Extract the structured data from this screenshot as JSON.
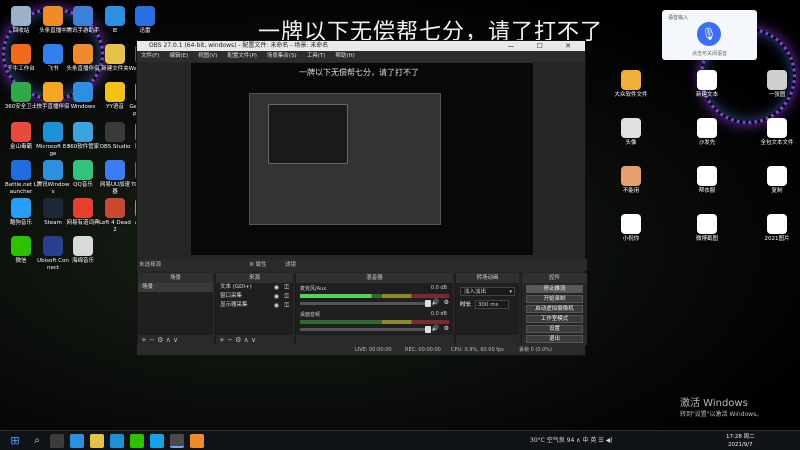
{
  "overlay": {
    "text": "一牌以下无偿帮七分，请了打不了"
  },
  "voice_widget": {
    "title": "语音输入",
    "status": "点击可关闭语音"
  },
  "desktop_icons": [
    {
      "label": "回收站",
      "color": "#9bb3c8"
    },
    {
      "label": "头条直播中",
      "color": "#f08b2c"
    },
    {
      "label": "腾讯手游助手",
      "color": "#3f7fd8"
    },
    {
      "label": "IE",
      "color": "#2d8fe0"
    },
    {
      "label": "迅雷",
      "color": "#2a6fe0"
    },
    {
      "label": "千牛工作台",
      "color": "#f26a1b"
    },
    {
      "label": "飞书",
      "color": "#2f80ed"
    },
    {
      "label": "头条直播伴侣",
      "color": "#f08b2c"
    },
    {
      "label": "新建文件夹",
      "color": "#e8c14a"
    },
    {
      "label": "Wallpaper Engine",
      "color": "#2f5fd0"
    },
    {
      "label": "360安全卫士",
      "color": "#30a94a"
    },
    {
      "label": "快手直播伴侣",
      "color": "#f5a623"
    },
    {
      "label": "Windows",
      "color": "#2d8fe0"
    },
    {
      "label": "YY语音",
      "color": "#f2c21a"
    },
    {
      "label": "GeForce Experience",
      "color": "#6cb33f"
    },
    {
      "label": "金山毒霸",
      "color": "#e84b3c"
    },
    {
      "label": "Microsoft Edge",
      "color": "#1e90d6"
    },
    {
      "label": "360软件管家",
      "color": "#3aa3e0"
    },
    {
      "label": "OBS Studio",
      "color": "#3a3a3a"
    },
    {
      "label": "腾讯QQ",
      "color": "#1aa2e8"
    },
    {
      "label": "Battle.net Launcher",
      "color": "#1e6ee0"
    },
    {
      "label": "腾讯Windows",
      "color": "#2d8fe0"
    },
    {
      "label": "QQ音乐",
      "color": "#31c27c"
    },
    {
      "label": "网易UU加速器",
      "color": "#3b7cf5"
    },
    {
      "label": "TC Games",
      "color": "#7b4df0"
    },
    {
      "label": "酷狗音乐",
      "color": "#2a9df4"
    },
    {
      "label": "Steam",
      "color": "#1b2838"
    },
    {
      "label": "网易有道词典",
      "color": "#e8402e"
    },
    {
      "label": "Left 4 Dead 2",
      "color": "#c8492f"
    },
    {
      "label": "a1eaeb",
      "color": "#6a9fd8"
    },
    {
      "label": "微信",
      "color": "#2dc100"
    },
    {
      "label": "Ubisoft Connect",
      "color": "#2a3f8f"
    },
    {
      "label": "海绵音乐",
      "color": "#d9d9d9"
    }
  ],
  "right_icons": [
    {
      "label": "大众软件文件",
      "color": "#f0b03a"
    },
    {
      "label": "新建文本",
      "color": "#ffffff"
    },
    {
      "label": "一张图",
      "color": "#cfcfcf"
    },
    {
      "label": "头像",
      "color": "#e0e0e0"
    },
    {
      "label": "沙发先",
      "color": "#ffffff"
    },
    {
      "label": "全包文本文件",
      "color": "#ffffff"
    },
    {
      "label": "不能用",
      "color": "#e8a070"
    },
    {
      "label": "帮衣服",
      "color": "#ffffff"
    },
    {
      "label": "复制",
      "color": "#ffffff"
    },
    {
      "label": "小祝你",
      "color": "#ffffff"
    },
    {
      "label": "微博截图",
      "color": "#ffffff"
    },
    {
      "label": "2021图片",
      "color": "#ffffff"
    }
  ],
  "obs": {
    "title": "OBS 27.0.1 (64-bit, windows) - 配置文件: 未命名 - 场景: 未命名",
    "win_buttons": "— ☐ ✕",
    "menu": [
      "文件(F)",
      "编辑(E)",
      "视图(V)",
      "配置文件(P)",
      "场景集合(S)",
      "工具(T)",
      "帮助(H)"
    ],
    "preview_text": "一牌以下无偿帮七分，请了打不了",
    "stream_status": "未选择源",
    "props_btn": "⚙ 属性",
    "filter_btn": "滤镜",
    "docks": {
      "scenes": {
        "title": "场景",
        "items": [
          "场景"
        ]
      },
      "sources": {
        "title": "来源",
        "items": [
          "文本 (GDI+)",
          "窗口采集",
          "显示器采集"
        ]
      },
      "mixer": {
        "title": "混音器",
        "channels": [
          {
            "name": "麦克风/Aux",
            "db": "0.0 dB"
          },
          {
            "name": "桌面音频",
            "db": "0.0 dB"
          }
        ]
      },
      "transitions": {
        "title": "转场动画",
        "selected": "淡入淡出",
        "duration_label": "时长",
        "duration": "300 ms"
      },
      "controls": {
        "title": "控件",
        "buttons": [
          "停止推流",
          "开始录制",
          "启动虚拟摄像机",
          "工作室模式",
          "设置",
          "退出"
        ]
      }
    },
    "status": {
      "live": "LIVE: 00:00:00",
      "rec": "REC: 00:00:00",
      "cpu": "CPU: 0.9%, 60.00 fps",
      "dropped": "丢帧 0 (0.0%)"
    },
    "dock_foot": "+ − ⚙ ∧ ∨"
  },
  "watermark": {
    "line1": "激活 Windows",
    "line2": "转到\"设置\"以激活 Windows。"
  },
  "taskbar": {
    "tray": "30°C 空气良 94  ∧  中  英  ☰  ◀)",
    "time": "17:28 周二",
    "date": "2021/9/7"
  }
}
